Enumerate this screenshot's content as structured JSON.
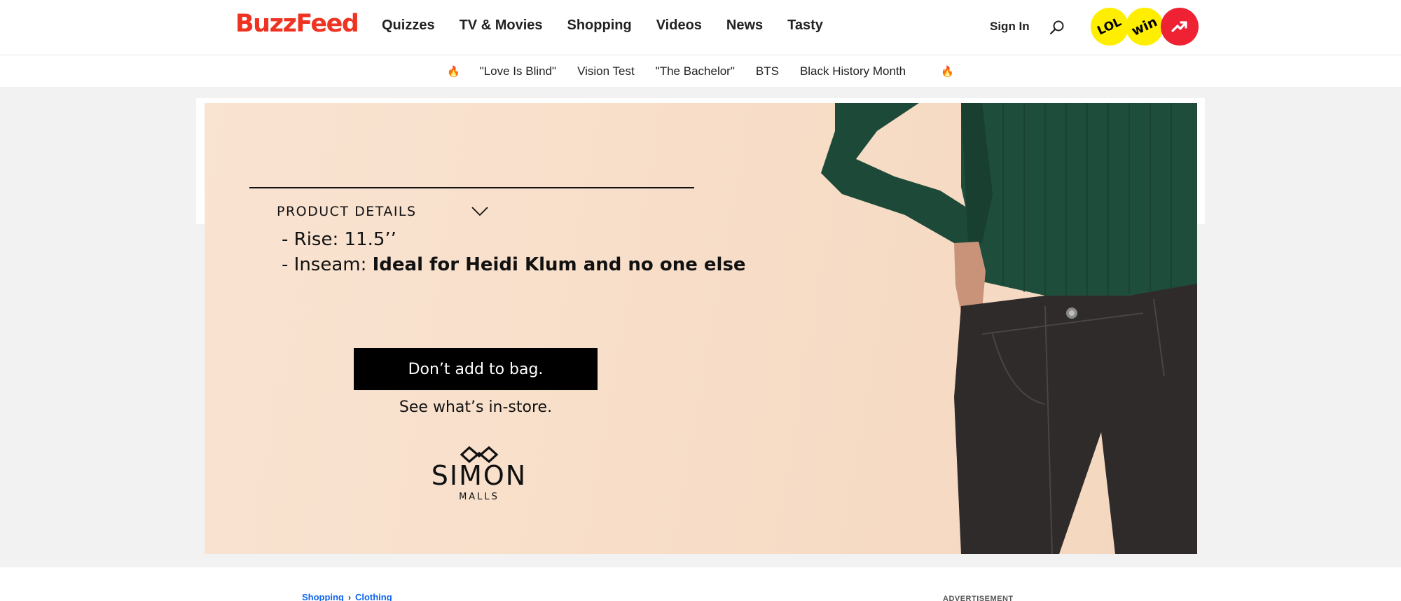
{
  "header": {
    "logo": "BuzzFeed",
    "nav": [
      "Quizzes",
      "TV & Movies",
      "Shopping",
      "Videos",
      "News",
      "Tasty"
    ],
    "sign_in": "Sign In",
    "search_icon": "search-icon",
    "badges": {
      "lol": "LOL",
      "win": "win",
      "trending_icon": "trending-arrow-icon"
    }
  },
  "trending": {
    "icon": "fire-icon",
    "items": [
      "\"Love Is Blind\"",
      "Vision Test",
      "\"The Bachelor\"",
      "BTS",
      "Black History Month"
    ]
  },
  "ad": {
    "section_title": "PRODUCT DETAILS",
    "line1": "- Rise: 11.5’’",
    "line2_prefix": "- Inseam: ",
    "line2_bold": "Ideal for Heidi Klum and no one else",
    "button": "Don’t add to bag.",
    "subtext": "See what’s in-store.",
    "brand": "SIMON",
    "brand_sub": "MALLS"
  },
  "breadcrumb": [
    "Shopping",
    "Clothing"
  ],
  "advertisement_label": "ADVERTISEMENT",
  "colors": {
    "brand_red": "#ee3322",
    "badge_yellow": "#ffee00",
    "badge_red": "#ee2233",
    "link_blue": "#0f65ef",
    "ad_peach": "#f8dfca"
  }
}
